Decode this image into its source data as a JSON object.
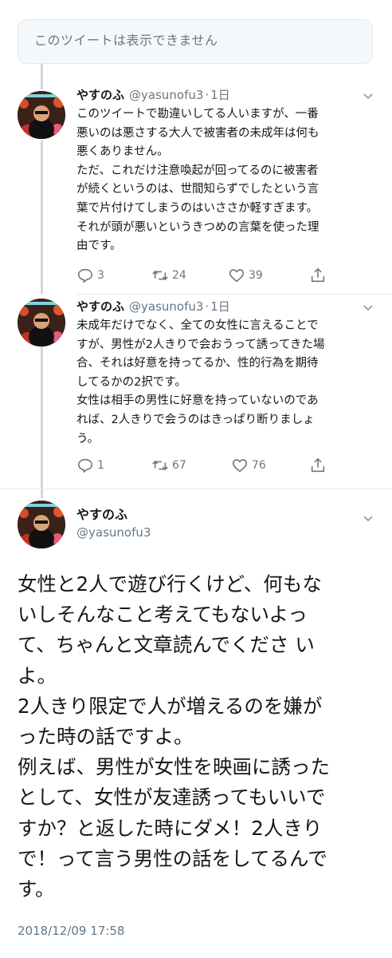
{
  "unavailable_notice": "このツイートは表示できません",
  "tweets": [
    {
      "name": "やすのふ",
      "handle": "@yasunofu3",
      "time": "1日",
      "text": "このツイートで勘違いしてる人いますが、一番\n悪いのは悪さする大人で被害者の未成年は何も\n悪くありません。\nただ、これだけ注意喚起が回ってるのに被害者\nが続くというのは、世間知らずでしたという言\n葉で片付けてしまうのはいささか軽すぎます。\nそれが頭が悪いというきつめの言葉を使った理\n由です。",
      "replies": "3",
      "retweets": "24",
      "likes": "39"
    },
    {
      "name": "やすのふ",
      "handle": "@yasunofu3",
      "time": "1日",
      "text": "未成年だけでなく、全ての女性に言えることで\nすが、男性が2人きりで会おうって誘ってきた場\n合、それは好意を持ってるか、性的行為を期待\nしてるかの2択です。\n女性は相手の男性に好意を持っていないのであ\nれば、2人きりで会うのはきっぱり断りましょ\nう。",
      "replies": "1",
      "retweets": "67",
      "likes": "76"
    }
  ],
  "main_tweet": {
    "name": "やすのふ",
    "handle": "@yasunofu3",
    "text": "女性と2人で遊び行くけど、何もな\nいしそんなこと考えてもないよっ\nて、ちゃんと文章読んでくださ い\nよ。\n2人きり限定で人が増えるのを嫌が\nった時の話ですよ。\n例えば、男性が女性を映画に誘った\nとして、女性が友達誘ってもいいで\nすか？と返した時にダメ！2人きり\nで！って言う男性の話をしてるんで\nす。",
    "timestamp": "2018/12/09 17:58"
  },
  "icons": {
    "reply": "reply-icon",
    "retweet": "retweet-icon",
    "like": "heart-icon",
    "share": "share-icon",
    "more": "chevron-down-icon"
  },
  "colors": {
    "text": "#14171a",
    "secondary": "#657786",
    "thread_line": "#ccd6dd",
    "notice_bg": "#f5f8fa"
  }
}
